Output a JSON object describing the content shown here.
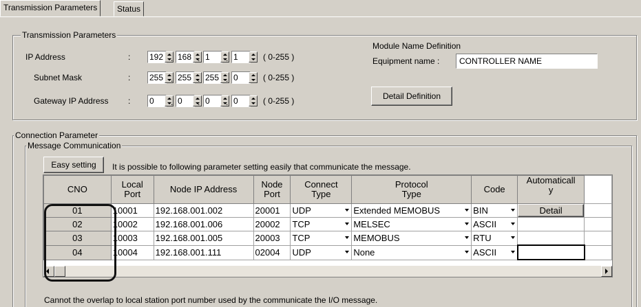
{
  "tabs": [
    {
      "label": "Transmission Parameters",
      "active": true
    },
    {
      "label": "Status",
      "active": false
    }
  ],
  "transmission": {
    "group_title": "Transmission Parameters",
    "ip": {
      "label": "IP Address",
      "colon": ":",
      "octets": [
        "192",
        "168",
        "1",
        "1"
      ],
      "range": "( 0-255 )"
    },
    "subnet": {
      "label": "Subnet Mask",
      "colon": ":",
      "octets": [
        "255",
        "255",
        "255",
        "0"
      ],
      "range": "( 0-255 )"
    },
    "gateway": {
      "label": "Gateway IP Address",
      "colon": ":",
      "octets": [
        "0",
        "0",
        "0",
        "0"
      ],
      "range": "( 0-255 )"
    },
    "dot": ".",
    "module_title": "Module Name Definition",
    "equipment_label": "Equipment name  :",
    "equipment_value": "CONTROLLER NAME",
    "detail_button": "Detail Definition"
  },
  "connection": {
    "group_title": "Connection Parameter",
    "message_title": "Message Communication",
    "easy_button": "Easy setting",
    "easy_hint": "It is possible to following parameter setting easily that communicate the  message.",
    "columns": {
      "cno": "CNO",
      "local_port": [
        "Local",
        "Port"
      ],
      "node_ip": "Node IP Address",
      "node_port": [
        "Node",
        "Port"
      ],
      "connect_type": [
        "Connect",
        "Type"
      ],
      "protocol_type": [
        "Protocol",
        "Type"
      ],
      "code": "Code",
      "auto": [
        "Automaticall",
        "y"
      ]
    },
    "rows": [
      {
        "cno": "01",
        "local_port": "10001",
        "node_ip": "192.168.001.002",
        "node_port": "20001",
        "connect": "UDP",
        "protocol": "Extended MEMOBUS",
        "code": "BIN",
        "auto": "Detail"
      },
      {
        "cno": "02",
        "local_port": "10002",
        "node_ip": "192.168.001.006",
        "node_port": "20002",
        "connect": "TCP",
        "protocol": "MELSEC",
        "code": "ASCII",
        "auto": ""
      },
      {
        "cno": "03",
        "local_port": "10003",
        "node_ip": "192.168.001.005",
        "node_port": "20003",
        "connect": "TCP",
        "protocol": "MEMOBUS",
        "code": "RTU",
        "auto": ""
      },
      {
        "cno": "04",
        "local_port": "10004",
        "node_ip": "192.168.001.111",
        "node_port": "02004",
        "connect": "UDP",
        "protocol": "None",
        "code": "ASCII",
        "auto": ""
      }
    ],
    "footer_note": "Cannot the overlap to local station port number used by the communicate the  I/O message."
  }
}
